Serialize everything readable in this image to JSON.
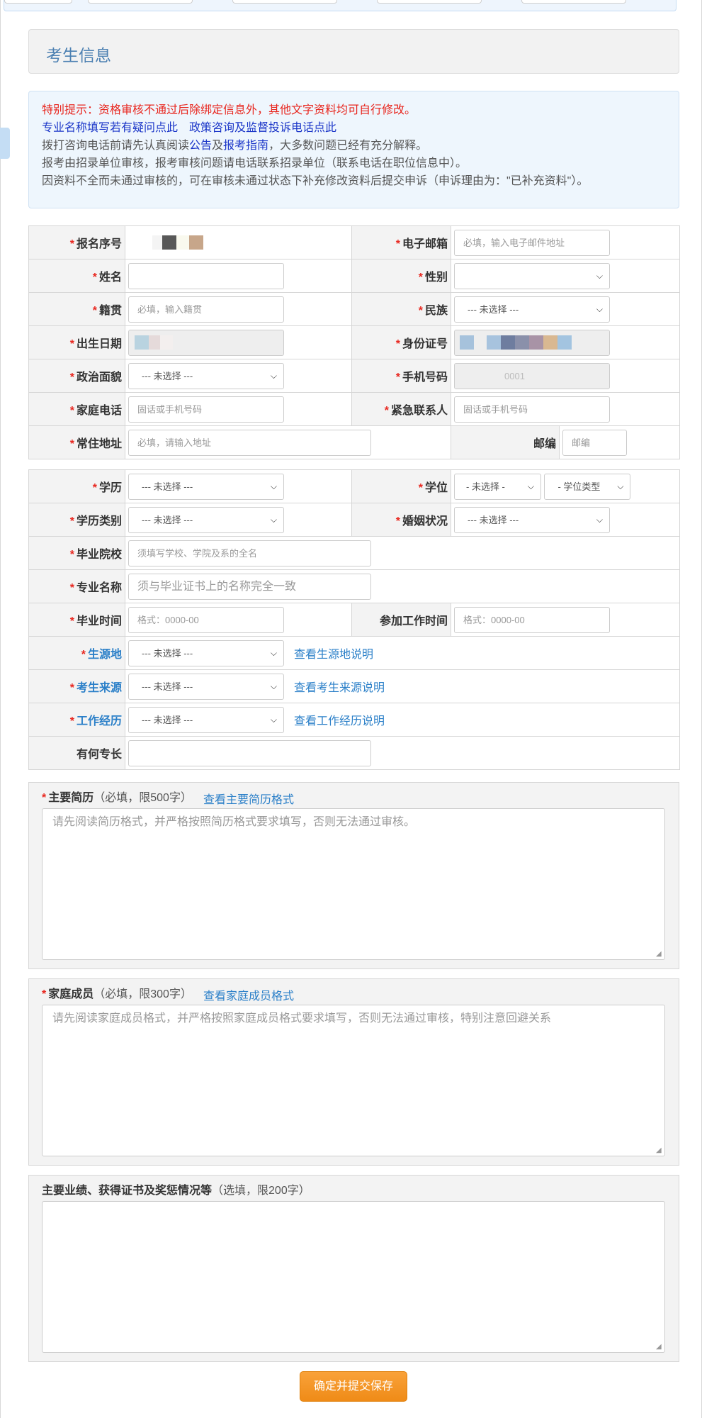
{
  "colors": {
    "accent_blue": "#4c80b2",
    "link_blue": "#2a7fc8",
    "warning_red": "#e8261e",
    "button_orange": "#f29019"
  },
  "section": {
    "title": "考生信息"
  },
  "notice": {
    "line1": "特别提示：资格审核不通过后除绑定信息外，其他文字资料均可自行修改。",
    "line2_link1": "专业名称填写若有疑问点此",
    "line2_link2": "政策咨询及监督投诉电话点此",
    "line3_prefix": "拨打咨询电话前请先认真阅读",
    "line3_link1": "公告",
    "line3_and": "及",
    "line3_link2": "报考指南",
    "line3_suffix": "，大多数问题已经有充分解释。",
    "line4": "报考由招录单位审核，报考审核问题请电话联系招录单位（联系电话在职位信息中）。",
    "line5": "因资料不全而未通过审核的，可在审核未通过状态下补充修改资料后提交申诉（申诉理由为：\"已补充资料\"）。"
  },
  "form1": {
    "reg_no": {
      "label": "报名序号",
      "value": ""
    },
    "email": {
      "label": "电子邮箱",
      "placeholder": "必填，输入电子邮件地址"
    },
    "name": {
      "label": "姓名",
      "value": ""
    },
    "gender": {
      "label": "性别",
      "value": ""
    },
    "native": {
      "label": "籍贯",
      "placeholder": "必填，输入籍贯"
    },
    "ethnicity": {
      "label": "民族",
      "value": "--- 未选择 ---"
    },
    "birth": {
      "label": "出生日期",
      "value": ""
    },
    "id_no": {
      "label": "身份证号",
      "value": ""
    },
    "politics": {
      "label": "政治面貌",
      "value": "--- 未选择 ---"
    },
    "mobile": {
      "label": "手机号码",
      "value": "0001"
    },
    "home_phone": {
      "label": "家庭电话",
      "placeholder": "固话或手机号码"
    },
    "emergency": {
      "label": "紧急联系人",
      "placeholder": "固话或手机号码"
    },
    "address": {
      "label": "常住地址",
      "placeholder": "必填，请输入地址"
    },
    "postcode": {
      "label": "邮编",
      "placeholder": "邮编"
    }
  },
  "form2": {
    "education": {
      "label": "学历",
      "value": "--- 未选择 ---"
    },
    "degree": {
      "label": "学位",
      "value": "- 未选择 -",
      "type_value": "- 学位类型"
    },
    "edu_type": {
      "label": "学历类别",
      "value": "--- 未选择 ---"
    },
    "marital": {
      "label": "婚姻状况",
      "value": "--- 未选择 ---"
    },
    "school": {
      "label": "毕业院校",
      "placeholder": "须填写学校、学院及系的全名"
    },
    "major": {
      "label": "专业名称",
      "placeholder": "须与毕业证书上的名称完全一致"
    },
    "grad_time": {
      "label": "毕业时间",
      "placeholder": "格式：0000-00"
    },
    "work_time": {
      "label": "参加工作时间",
      "placeholder": "格式：0000-00"
    },
    "origin": {
      "label": "生源地",
      "value": "--- 未选择 ---",
      "link": "查看生源地说明"
    },
    "source": {
      "label": "考生来源",
      "value": "--- 未选择 ---",
      "link": "查看考生来源说明"
    },
    "experience": {
      "label": "工作经历",
      "value": "--- 未选择 ---",
      "link": "查看工作经历说明"
    },
    "specialty": {
      "label": "有何专长",
      "value": ""
    }
  },
  "resume": {
    "label": "主要简历",
    "note": "（必填，限500字）",
    "link": "查看主要简历格式",
    "placeholder": "请先阅读简历格式，并严格按照简历格式要求填写，否则无法通过审核。"
  },
  "family": {
    "label": "家庭成员",
    "note": "（必填，限300字）",
    "link": "查看家庭成员格式",
    "placeholder": "请先阅读家庭成员格式，并严格按照家庭成员格式要求填写，否则无法通过审核，特别注意回避关系"
  },
  "awards": {
    "label": "主要业绩、获得证书及奖惩情况等",
    "note": "（选填，限200字）",
    "placeholder": ""
  },
  "submit": {
    "label": "确定并提交保存"
  }
}
